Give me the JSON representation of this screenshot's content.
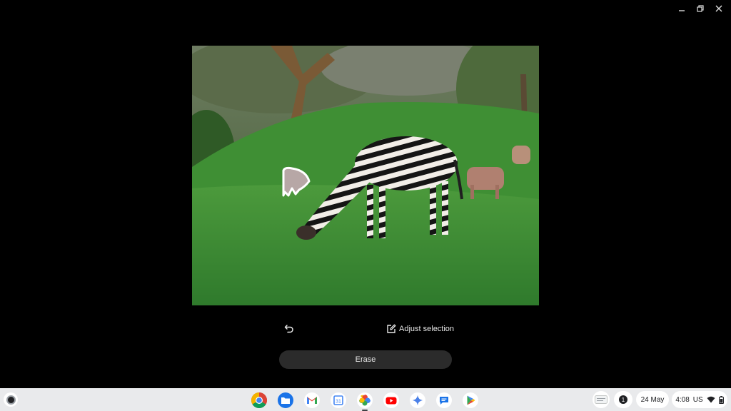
{
  "window": {
    "controls": [
      "minimize",
      "restore",
      "close"
    ]
  },
  "editor": {
    "adjust_label": "Adjust selection",
    "erase_label": "Erase"
  },
  "shelf": {
    "apps": [
      {
        "name": "Chrome",
        "icon": "chrome-icon"
      },
      {
        "name": "Files",
        "icon": "files-icon"
      },
      {
        "name": "Gmail",
        "icon": "gmail-icon"
      },
      {
        "name": "Calendar",
        "icon": "calendar-icon",
        "text": "31"
      },
      {
        "name": "Photos",
        "icon": "photos-icon",
        "active": true
      },
      {
        "name": "YouTube",
        "icon": "youtube-icon"
      },
      {
        "name": "Gemini",
        "icon": "gemini-icon"
      },
      {
        "name": "Messages",
        "icon": "messages-icon"
      },
      {
        "name": "Play Store",
        "icon": "play-store-icon"
      }
    ],
    "notification_count": "1",
    "date": "24 May",
    "time": "4:08",
    "locale": "US"
  },
  "colors": {
    "shelf_bg": "#e9eaec",
    "erase_button_bg": "#2b2b2b",
    "window_bg": "#000000"
  }
}
